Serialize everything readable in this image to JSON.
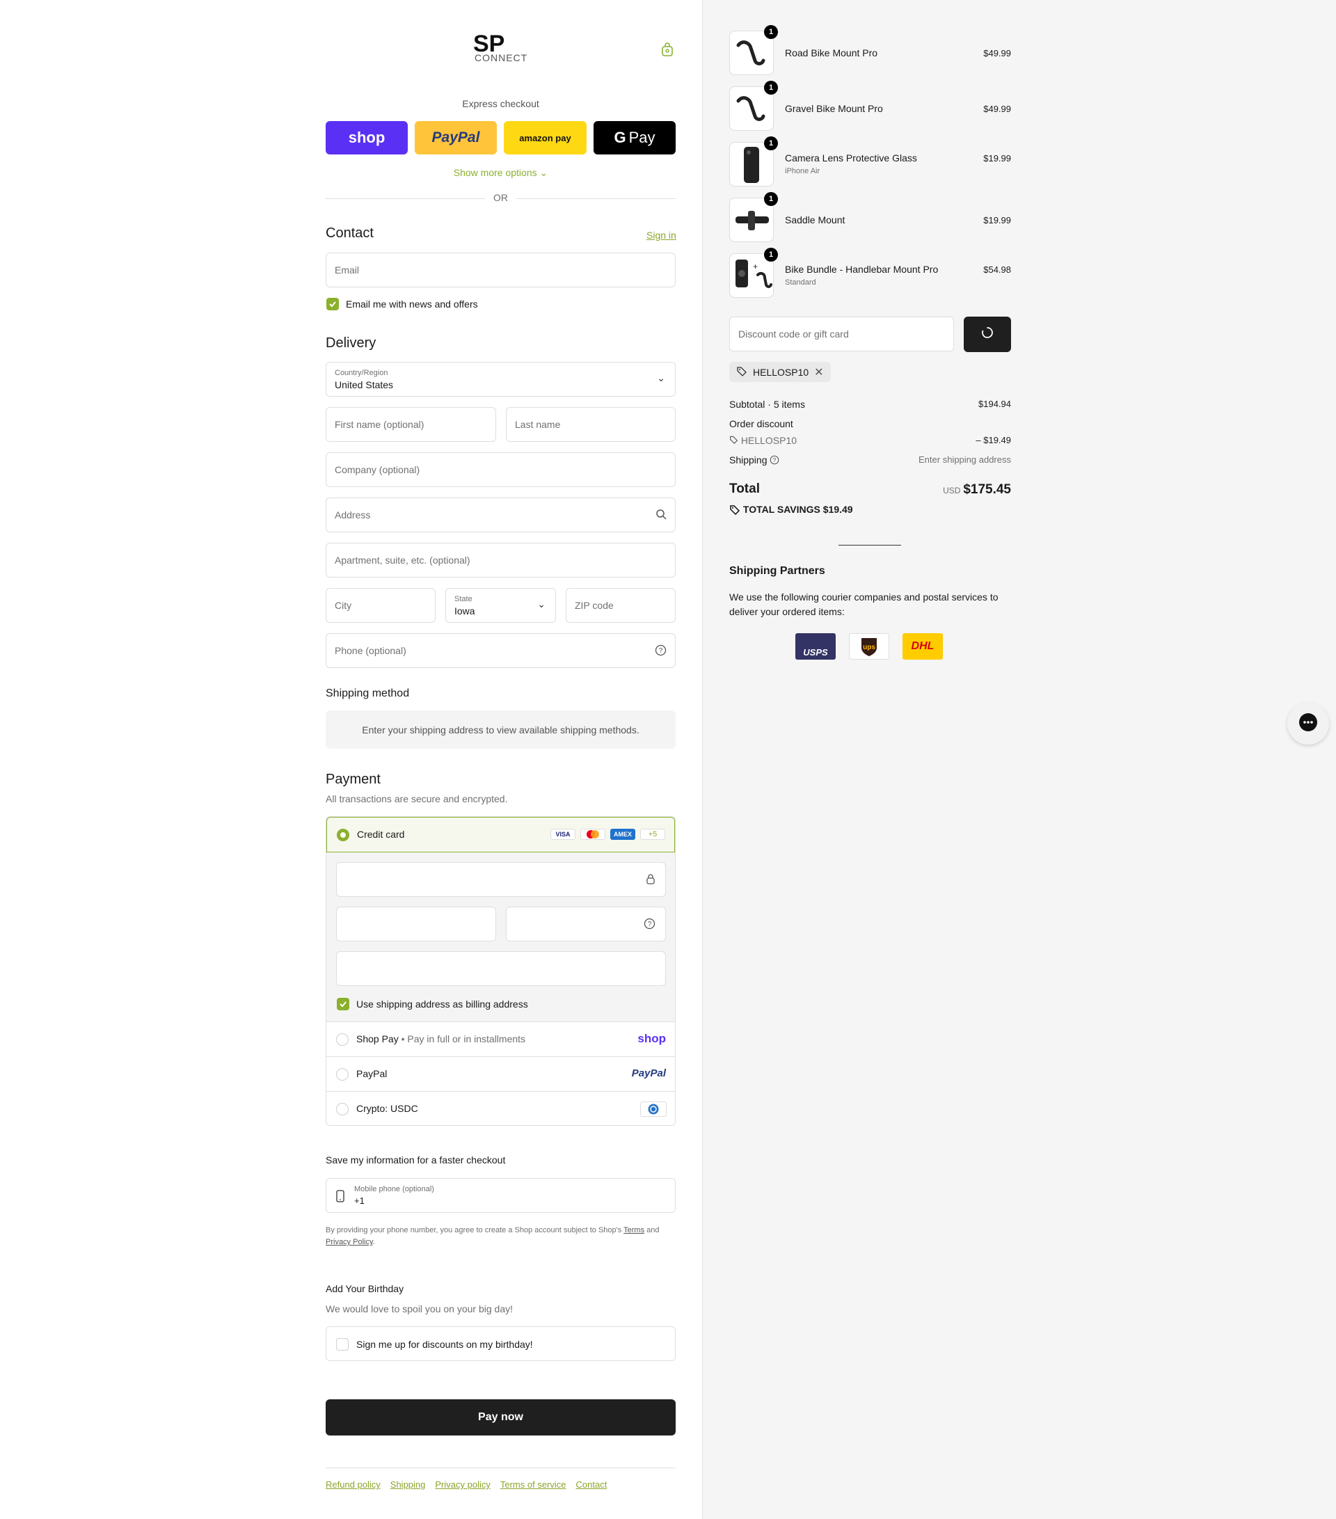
{
  "brand": {
    "logo_text": "SP",
    "logo_sub": "CONNECT"
  },
  "express": {
    "title": "Express checkout",
    "shop_label": "shop",
    "paypal_label": "PayPal",
    "amazon_label": "amazon pay",
    "gpay_label": "Pay",
    "more_options": "Show more options",
    "or_label": "OR"
  },
  "contact": {
    "title": "Contact",
    "sign_in": "Sign in",
    "email_placeholder": "Email",
    "news_label": "Email me with news and offers"
  },
  "delivery": {
    "title": "Delivery",
    "country_label": "Country/Region",
    "country_value": "United States",
    "first_name": "First name (optional)",
    "last_name": "Last name",
    "company": "Company (optional)",
    "address": "Address",
    "apartment": "Apartment, suite, etc. (optional)",
    "city": "City",
    "state_label": "State",
    "state_value": "Iowa",
    "zip": "ZIP code",
    "phone": "Phone (optional)"
  },
  "shipping_method": {
    "title": "Shipping method",
    "notice": "Enter your shipping address to view available shipping methods."
  },
  "payment": {
    "title": "Payment",
    "subtitle": "All transactions are secure and encrypted.",
    "credit_card": "Credit card",
    "card_brands": [
      "VISA",
      "Mastercard",
      "AMEX"
    ],
    "more_cards": "+5",
    "billing_label": "Use shipping address as billing address",
    "shop_pay": "Shop Pay",
    "shop_pay_sub": "Pay in full or in installments",
    "shop_logo": "shop",
    "paypal": "PayPal",
    "paypal_logo": "PayPal",
    "crypto": "Crypto: USDC"
  },
  "save_info": {
    "title": "Save my information for a faster checkout",
    "phone_label": "Mobile phone (optional)",
    "phone_value": "+1",
    "legal_1": "By providing your phone number, you agree to create a Shop account subject to Shop's",
    "terms": "Terms",
    "and": "and",
    "privacy": "Privacy Policy"
  },
  "birthday": {
    "title": "Add Your Birthday",
    "subtitle": "We would love to spoil you on your big day!",
    "signup": "Sign me up for discounts on my birthday!"
  },
  "pay_now": "Pay now",
  "footer_links": [
    "Refund policy",
    "Shipping",
    "Privacy policy",
    "Terms of service",
    "Contact"
  ],
  "cart": {
    "items": [
      {
        "name": "Road Bike Mount Pro",
        "variant": "",
        "qty": "1",
        "price": "$49.99"
      },
      {
        "name": "Gravel Bike Mount Pro",
        "variant": "",
        "qty": "1",
        "price": "$49.99"
      },
      {
        "name": "Camera Lens Protective Glass",
        "variant": "iPhone Air",
        "qty": "1",
        "price": "$19.99"
      },
      {
        "name": "Saddle Mount",
        "variant": "",
        "qty": "1",
        "price": "$19.99"
      },
      {
        "name": "Bike Bundle - Handlebar Mount Pro",
        "variant": "Standard",
        "qty": "1",
        "price": "$54.98"
      }
    ],
    "discount_placeholder": "Discount code or gift card",
    "applied_code": "HELLOSP10",
    "subtotal_label": "Subtotal · 5 items",
    "subtotal_value": "$194.94",
    "order_discount_label": "Order discount",
    "discount_code": "HELLOSP10",
    "discount_value": "– $19.49",
    "shipping_label": "Shipping",
    "shipping_value": "Enter shipping address",
    "total_label": "Total",
    "currency": "USD",
    "total_value": "$175.45",
    "savings_label": "TOTAL SAVINGS",
    "savings_value": "$19.49"
  },
  "partners": {
    "title": "Shipping Partners",
    "text": "We use the following courier companies and postal services to deliver your ordered items:",
    "logos": [
      "USPS",
      "ups",
      "DHL"
    ]
  },
  "colors": {
    "accent": "#8bb02d",
    "shop": "#5a31f4",
    "paypal": "#ffc439",
    "amazon": "#ffd814",
    "dark": "#1f1f1f"
  }
}
